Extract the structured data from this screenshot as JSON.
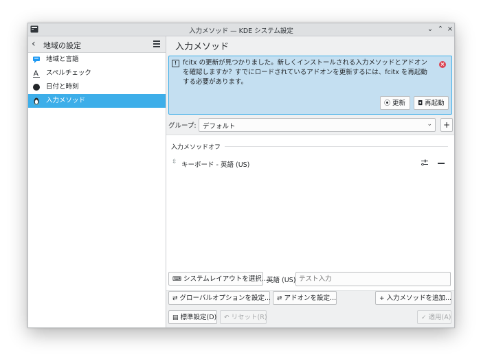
{
  "window": {
    "title": "入力メソッド — KDE システム設定"
  },
  "sidebar": {
    "title": "地域の設定",
    "items": [
      {
        "label": "地域と言語",
        "icon": "speech-bubble-icon"
      },
      {
        "label": "スペルチェック",
        "icon": "spellcheck-icon"
      },
      {
        "label": "日付と時刻",
        "icon": "clock-icon"
      },
      {
        "label": "入力メソッド",
        "icon": "penguin-icon",
        "active": true
      }
    ]
  },
  "page": {
    "title": "入力メソッド"
  },
  "notice": {
    "text": "fcitx の更新が見つかりました。新しくインストールされる入力メソッドとアドオンを確認しますか？すでにロードされているアドオンを更新するには、fcitx を再起動する必要があります。",
    "update_label": "更新",
    "restart_label": "再起動"
  },
  "group": {
    "label": "グループ:",
    "value": "デフォルト",
    "add": "+"
  },
  "list": {
    "section": "入力メソッドオフ",
    "items": [
      {
        "label": "キーボード - 英語 (US)"
      }
    ]
  },
  "bottom": {
    "select_layout": "システムレイアウトを選択...",
    "layout_name": "英語 (US)",
    "test_placeholder": "テスト入力",
    "global_options": "グローバルオプションを設定...",
    "addons": "アドオンを設定...",
    "add_im": "入力メソッドを追加...",
    "defaults": "標準設定(D)",
    "reset": "リセット(R)",
    "apply": "適用(A)"
  },
  "colors": {
    "accent": "#3daee9",
    "notice_bg": "#c4dff1",
    "close_red": "#da4453"
  }
}
